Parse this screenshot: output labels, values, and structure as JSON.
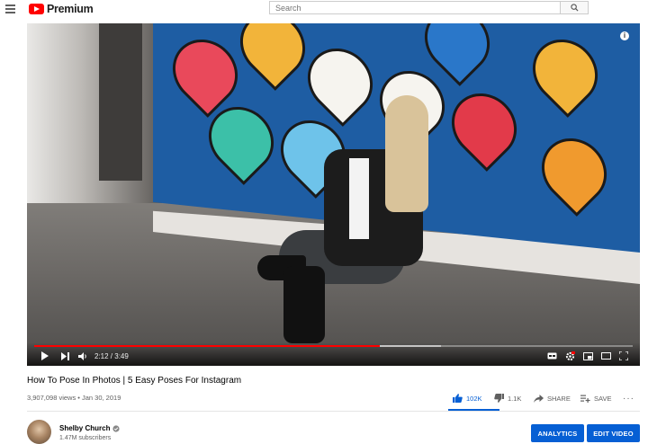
{
  "header": {
    "menu_icon": "hamburger-menu-icon",
    "logo_text": "Premium",
    "logo_icon": "youtube-play-logo-icon",
    "search_placeholder": "Search",
    "search_icon": "search-icon"
  },
  "player": {
    "time": "2:12 / 3:49",
    "progress_fraction": 0.577,
    "buffered_fraction": 0.68,
    "progress_color": "#ff0000",
    "info_icon": "info-icon",
    "controls": [
      "play-icon",
      "next-icon",
      "volume-icon",
      "captions-icon",
      "settings-icon",
      "miniplayer-icon",
      "theater-icon",
      "fullscreen-icon"
    ]
  },
  "video": {
    "title": "How To Pose In Photos | 5 Easy Poses For Instagram",
    "views": "3,907,098 views",
    "separator": " • ",
    "date": "Jan 30, 2019",
    "likes": "102K",
    "dislikes": "1.1K",
    "share_label": "SHARE",
    "save_label": "SAVE",
    "more_label": "···"
  },
  "channel": {
    "name": "Shelby Church",
    "verified_icon": "verified-check-icon",
    "subscribers": "1.47M subscribers",
    "analytics_label": "ANALYTICS",
    "edit_label": "EDIT VIDEO"
  },
  "colors": {
    "accent": "#065fd4",
    "brand": "#ff0000",
    "meta_text": "#606060"
  }
}
